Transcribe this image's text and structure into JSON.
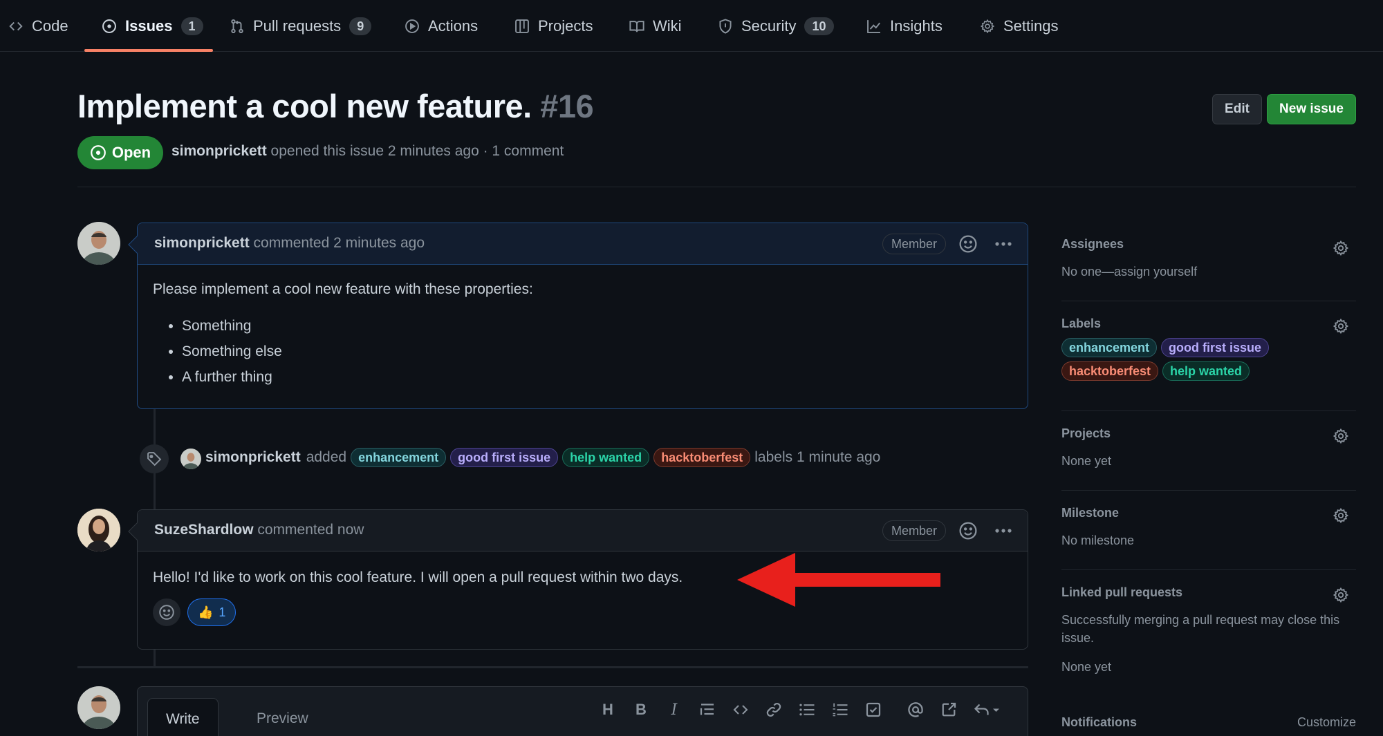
{
  "nav": {
    "tabs": [
      {
        "label": "Code",
        "icon": "code-icon",
        "count": null
      },
      {
        "label": "Issues",
        "icon": "issue-opened-icon",
        "count": "1"
      },
      {
        "label": "Pull requests",
        "icon": "git-pull-request-icon",
        "count": "9"
      },
      {
        "label": "Actions",
        "icon": "play-icon",
        "count": null
      },
      {
        "label": "Projects",
        "icon": "table-icon",
        "count": null
      },
      {
        "label": "Wiki",
        "icon": "book-icon",
        "count": null
      },
      {
        "label": "Security",
        "icon": "shield-icon",
        "count": "10"
      },
      {
        "label": "Insights",
        "icon": "graph-icon",
        "count": null
      },
      {
        "label": "Settings",
        "icon": "gear-icon",
        "count": null
      }
    ],
    "active_tab": "Issues",
    "active_color": "#f78166"
  },
  "issue": {
    "title": "Implement a cool new feature.",
    "number": "#16",
    "state": "Open",
    "author": "simonprickett",
    "meta": "opened this issue 2 minutes ago · 1 comment",
    "edit_label": "Edit",
    "new_issue_label": "New issue"
  },
  "comments": [
    {
      "author": "simonprickett",
      "action": "commented 2 minutes ago",
      "badge": "Member",
      "intro": "Please implement a cool new feature with these properties:",
      "items": [
        "Something",
        "Something else",
        "A further thing"
      ]
    },
    {
      "author": "SuzeShardlow",
      "action": "commented now",
      "badge": "Member",
      "text": "Hello! I'd like to work on this cool feature. I will open a pull request within two days.",
      "reaction": {
        "emoji": "👍",
        "count": "1"
      }
    }
  ],
  "label_event": {
    "author": "simonprickett",
    "verb": "added",
    "labels": [
      "enhancement",
      "good first issue",
      "help wanted",
      "hacktoberfest"
    ],
    "suffix": "labels 1 minute ago"
  },
  "editor": {
    "tabs": [
      "Write",
      "Preview"
    ],
    "tools": [
      "heading-icon",
      "bold-icon",
      "italic-icon",
      "quote-icon",
      "code-icon",
      "link-icon",
      "bulleted-list-icon",
      "numbered-list-icon",
      "tasklist-icon",
      "mention-icon",
      "cross-reference-icon",
      "reply-icon"
    ]
  },
  "sidebar": {
    "assignees": {
      "title": "Assignees",
      "value": "No one—assign yourself"
    },
    "labels": {
      "title": "Labels",
      "items": [
        "enhancement",
        "good first issue",
        "hacktoberfest",
        "help wanted"
      ]
    },
    "projects": {
      "title": "Projects",
      "value": "None yet"
    },
    "milestone": {
      "title": "Milestone",
      "value": "No milestone"
    },
    "linked_prs": {
      "title": "Linked pull requests",
      "description": "Successfully merging a pull request may close this issue.",
      "value": "None yet"
    },
    "notifications": {
      "title": "Notifications",
      "action": "Customize"
    }
  },
  "colors": {
    "background": "#0d1117",
    "open_green": "#238636",
    "annotation_arrow": "#e8201c",
    "label_enhancement": "#84d6de",
    "label_good_first_issue": "#b9aefc",
    "label_help_wanted": "#2bd4a8",
    "label_hacktoberfest": "#f98c75"
  }
}
